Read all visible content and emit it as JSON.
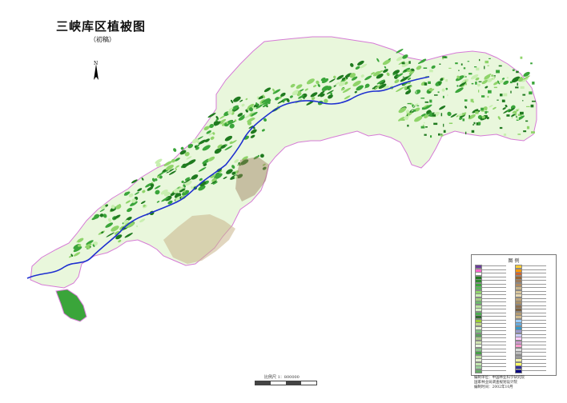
{
  "map": {
    "title": "三峡库区植被图",
    "subtitle": "（初稿）",
    "north_label": "N",
    "legend_title": "图 例",
    "scale_text": "比例尺 1：800000",
    "credits": [
      "编制单位：中国林业科学研究院",
      "国家林业局调查规划设计院",
      "编制时间：2002年10月"
    ],
    "colors": {
      "boundary": "#d67bd6",
      "river": "#1e2fd0",
      "forest_dark": "#1f7a1f",
      "forest": "#3aa53a",
      "shrub": "#8fd46a",
      "grass": "#c8efb0",
      "agri": "#e9f7dc",
      "brown": "#9b7b5b",
      "tan": "#c8b48a"
    },
    "legend_colors": [
      "#6a3d9a",
      "#ff66cc",
      "#ffffff",
      "#1f7a1f",
      "#2e8b2e",
      "#3aa53a",
      "#56b856",
      "#8fd46a",
      "#c8efb0",
      "#a0d080",
      "#6bb86b",
      "#b9e3a0",
      "#d0f0c0",
      "#4caf50",
      "#2d6a2d",
      "#9acd32",
      "#c0d98a",
      "#e0f0d0",
      "#7fbf7f",
      "#5c9e5c",
      "#a8c88a",
      "#cfe3b0",
      "#e6f5dc",
      "#8cc68c",
      "#46a046",
      "#b8dca0",
      "#dfeecf",
      "#c3e6b0",
      "#9bd09b",
      "#66aa66",
      "#ffcc33",
      "#ff9900",
      "#cc6633",
      "#996633",
      "#9b7b5b",
      "#b08a60",
      "#c8b48a",
      "#d8c49a",
      "#e8d8b0",
      "#bfa67a",
      "#a98f66",
      "#8c6f4f",
      "#7a6040",
      "#b49a70",
      "#d0bc90",
      "#99ccff",
      "#66aadd",
      "#3399cc",
      "#9999cc",
      "#ccccff",
      "#ffccff",
      "#cc99cc",
      "#ff99cc",
      "#dddddd",
      "#bbbbbb",
      "#999999",
      "#eeeeaa",
      "#ffff66",
      "#333399",
      "#000080"
    ]
  }
}
